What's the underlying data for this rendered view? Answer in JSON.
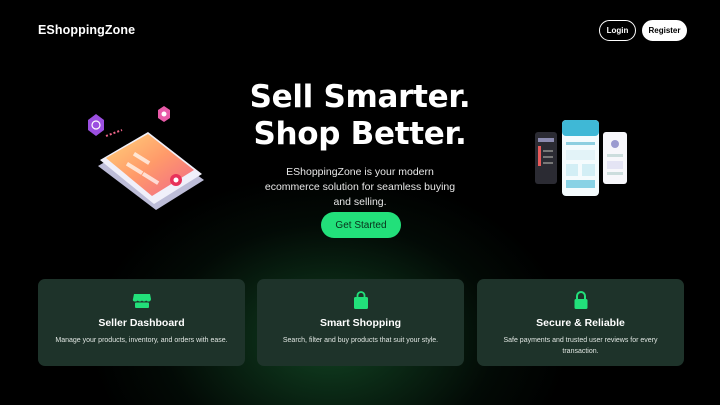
{
  "brand": "EShoppingZone",
  "nav": {
    "login_label": "Login",
    "register_label": "Register"
  },
  "hero": {
    "title_line1": "Sell Smarter.",
    "title_line2": "Shop Better.",
    "subtitle": "EShoppingZone is your modern ecommerce solution for seamless buying and selling.",
    "cta_label": "Get Started"
  },
  "features": [
    {
      "icon": "store-icon",
      "title": "Seller Dashboard",
      "description": "Manage your products, inventory, and orders with ease."
    },
    {
      "icon": "shopping-bag-icon",
      "title": "Smart Shopping",
      "description": "Search, filter and buy products that suit your style."
    },
    {
      "icon": "lock-icon",
      "title": "Secure & Reliable",
      "description": "Safe payments and trusted user reviews for every transaction."
    }
  ],
  "colors": {
    "accent": "#22e07a",
    "card_bg": "#1e332a",
    "background": "#000000"
  }
}
